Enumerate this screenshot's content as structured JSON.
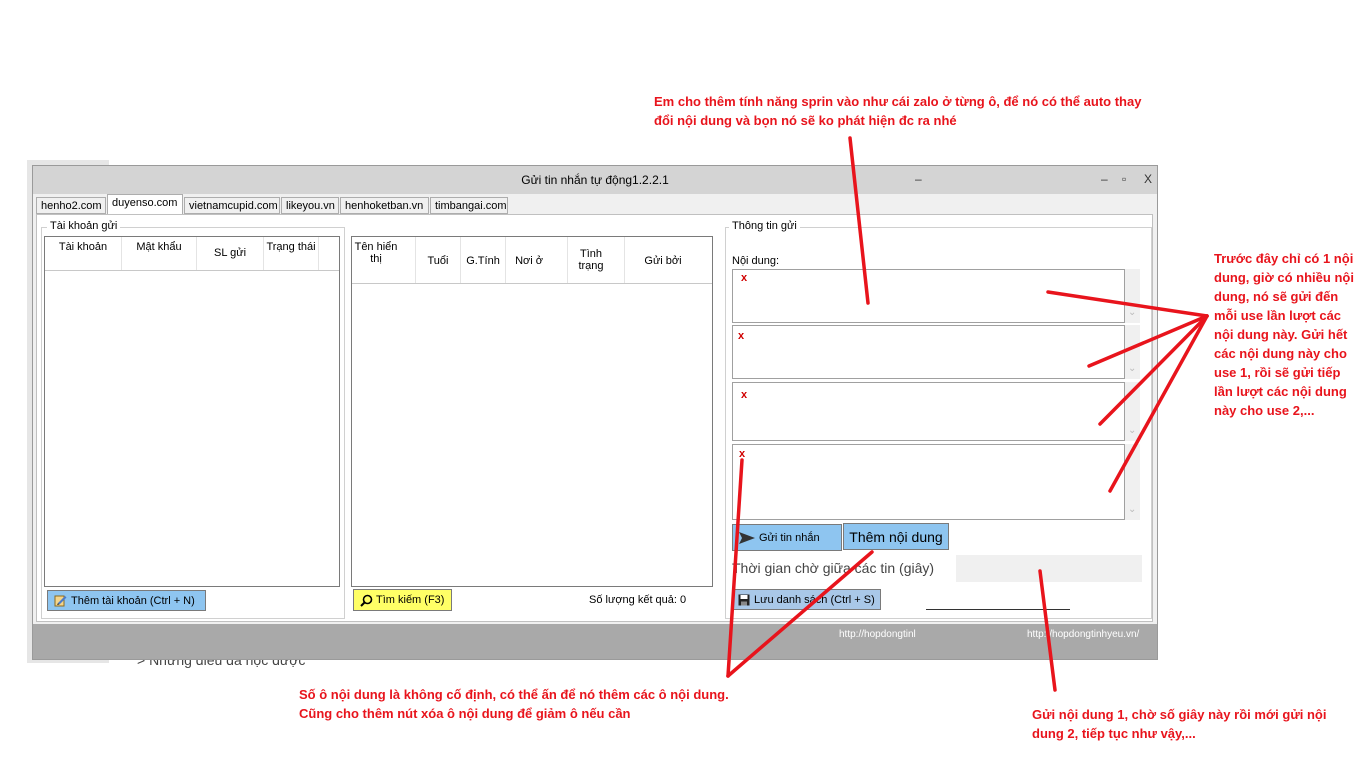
{
  "background": {
    "text": "> Những điều đã học được"
  },
  "window": {
    "title": "Gửi tin nhắn tự động1.2.2.1",
    "min_glyph": "–",
    "max_glyph": "▫",
    "close_glyph": "X"
  },
  "tabs": [
    {
      "label": "henho2.com"
    },
    {
      "label": "duyenso.com"
    },
    {
      "label": "vietnamcupid.com"
    },
    {
      "label": "likeyou.vn"
    },
    {
      "label": "henhoketban.vn"
    },
    {
      "label": "timbangai.com"
    }
  ],
  "accounts": {
    "group_label": "Tài khoản gửi",
    "columns": [
      "Tài khoản",
      "Mật khẩu",
      "SL gửi",
      "Trạng thái"
    ],
    "add_button": "Thêm tài khoản (Ctrl + N)"
  },
  "results": {
    "columns": [
      "Tên hiển thị",
      "Tuổi",
      "G.Tính",
      "Nơi ở",
      "Tình trạng",
      "Gửi bởi"
    ],
    "search_button": "Tìm kiếm (F3)",
    "count_label": "Số lượng kết quả: 0"
  },
  "send_info": {
    "group_label": "Thông tin gửi",
    "content_label": "Nội dung:",
    "delete_mark": "x",
    "send_button": "Gửi tin nhắn",
    "add_content_button": "Thêm nội dung",
    "wait_label": "Thời gian chờ giữa các tin (giây)",
    "wait_value": "",
    "save_button": "Lưu danh sách (Ctrl + S)"
  },
  "status_links": [
    "http://hopdongtinl",
    "http://hopdongtinhyeu.vn/"
  ],
  "annotations": {
    "top": "Em cho thêm tính năng sprin vào như cái zalo ở từng ô, để nó có thể auto thay đổi nội dung và bọn nó sẽ ko phát hiện đc ra nhé",
    "right": " Trước đây chỉ có 1 nội dung, giờ có nhiều nội dung, nó sẽ gửi đến mỗi use lần lượt các nội dung này. Gửi hết các nội dung này cho use 1, rồi sẽ gửi tiếp lần lượt các nội dung này cho use 2,...",
    "bottom_left": "Số ô nội dung là không cố định, có thể ấn để nó thêm các ô nội dung. Cũng cho thêm nút xóa ô nội dung để giảm ô nếu cần",
    "bottom_right": "Gửi nội dung 1, chờ số giây này rồi mới gửi nội dung 2, tiếp tục như vậy,..."
  },
  "colors": {
    "annotation": "#e8141c",
    "button_blue": "#8ec5f0",
    "button_yellow": "#ffff66",
    "delete_mark": "#d00000"
  }
}
